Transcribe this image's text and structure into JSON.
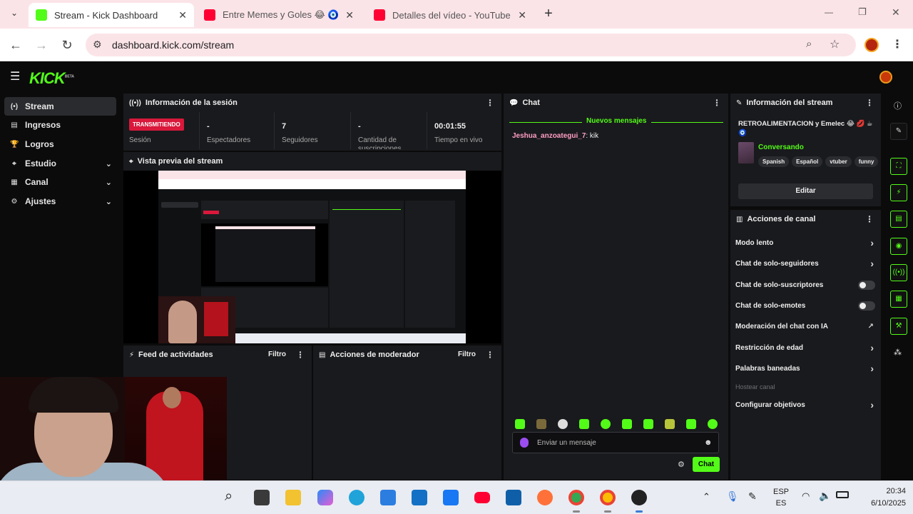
{
  "browser": {
    "tabs": [
      {
        "title": "Stream - Kick Dashboard",
        "favicon_color": "#53fc18",
        "active": true
      },
      {
        "title": "Entre Memes y Goles 😂 🧿 - Y",
        "favicon_color": "#ff0033",
        "active": false
      },
      {
        "title": "Detalles del vídeo - YouTube St",
        "favicon_color": "#ff0033",
        "active": false
      }
    ],
    "close_glyph": "✕",
    "new_tab_glyph": "+",
    "url": "dashboard.kick.com/stream",
    "window_controls": {
      "minimize": "—",
      "maximize": "❐",
      "close": "✕"
    }
  },
  "kick": {
    "logo_text": "KICK",
    "logo_badge": "BETA",
    "accent_color": "#53fc18",
    "sidebar": [
      {
        "label": "Stream",
        "icon": "broadcast-icon",
        "glyph": "(•)",
        "active": true,
        "expandable": false
      },
      {
        "label": "Ingresos",
        "icon": "revenue-icon",
        "glyph": "▤",
        "active": false,
        "expandable": false
      },
      {
        "label": "Logros",
        "icon": "trophy-icon",
        "glyph": "🏆",
        "active": false,
        "expandable": false
      },
      {
        "label": "Estudio",
        "icon": "studio-icon",
        "glyph": "⌖",
        "active": false,
        "expandable": true
      },
      {
        "label": "Canal",
        "icon": "channel-icon",
        "glyph": "▦",
        "active": false,
        "expandable": true
      },
      {
        "label": "Ajustes",
        "icon": "gear-icon",
        "glyph": "⚙",
        "active": false,
        "expandable": true
      }
    ],
    "session": {
      "title": "Información de la sesión",
      "status": "TRANSMITIENDO",
      "status_label": "Sesión",
      "stats": [
        {
          "value": "-",
          "label": "Espectadores"
        },
        {
          "value": "7",
          "label": "Seguidores"
        },
        {
          "value": "-",
          "label": "Cantidad de suscripciones"
        },
        {
          "value": "00:01:55",
          "label": "Tiempo en vivo"
        }
      ]
    },
    "preview": {
      "title": "Vista previa del stream"
    },
    "activity_feed": {
      "title": "Feed de actividades",
      "filter": "Filtro"
    },
    "mod_actions": {
      "title": "Acciones de moderador",
      "filter": "Filtro"
    },
    "chat": {
      "title": "Chat",
      "new_messages": "Nuevos mensajes",
      "messages": [
        {
          "user": "Jeshua_anzoategui_7",
          "text": ": kik"
        }
      ],
      "input_placeholder": "Enviar un mensaje",
      "send_label": "Chat"
    },
    "stream_info": {
      "title": "Información del stream",
      "stream_title": "RETROALIMENTACION y Emelec 😂 💋 ☕ 🧿",
      "category": "Conversando",
      "tags": [
        "Spanish",
        "Español",
        "vtuber",
        "funny"
      ],
      "edit_label": "Editar"
    },
    "channel_actions": {
      "title": "Acciones de canal",
      "items": [
        {
          "label": "Modo lento",
          "control": "arrow"
        },
        {
          "label": "Chat de solo-seguidores",
          "control": "arrow"
        },
        {
          "label": "Chat de solo-suscriptores",
          "control": "toggle"
        },
        {
          "label": "Chat de solo-emotes",
          "control": "toggle"
        },
        {
          "label": "Moderación del chat con IA",
          "control": "external"
        },
        {
          "label": "Restricción de edad",
          "control": "arrow"
        },
        {
          "label": "Palabras baneadas",
          "control": "arrow"
        },
        {
          "label": "Hostear canal",
          "control": "none",
          "disabled": true
        },
        {
          "label": "Configurar objetivos",
          "control": "arrow"
        }
      ]
    }
  },
  "taskbar": {
    "language": "ESP",
    "region": "ES",
    "time": "20:34",
    "date": "6/10/2025"
  }
}
